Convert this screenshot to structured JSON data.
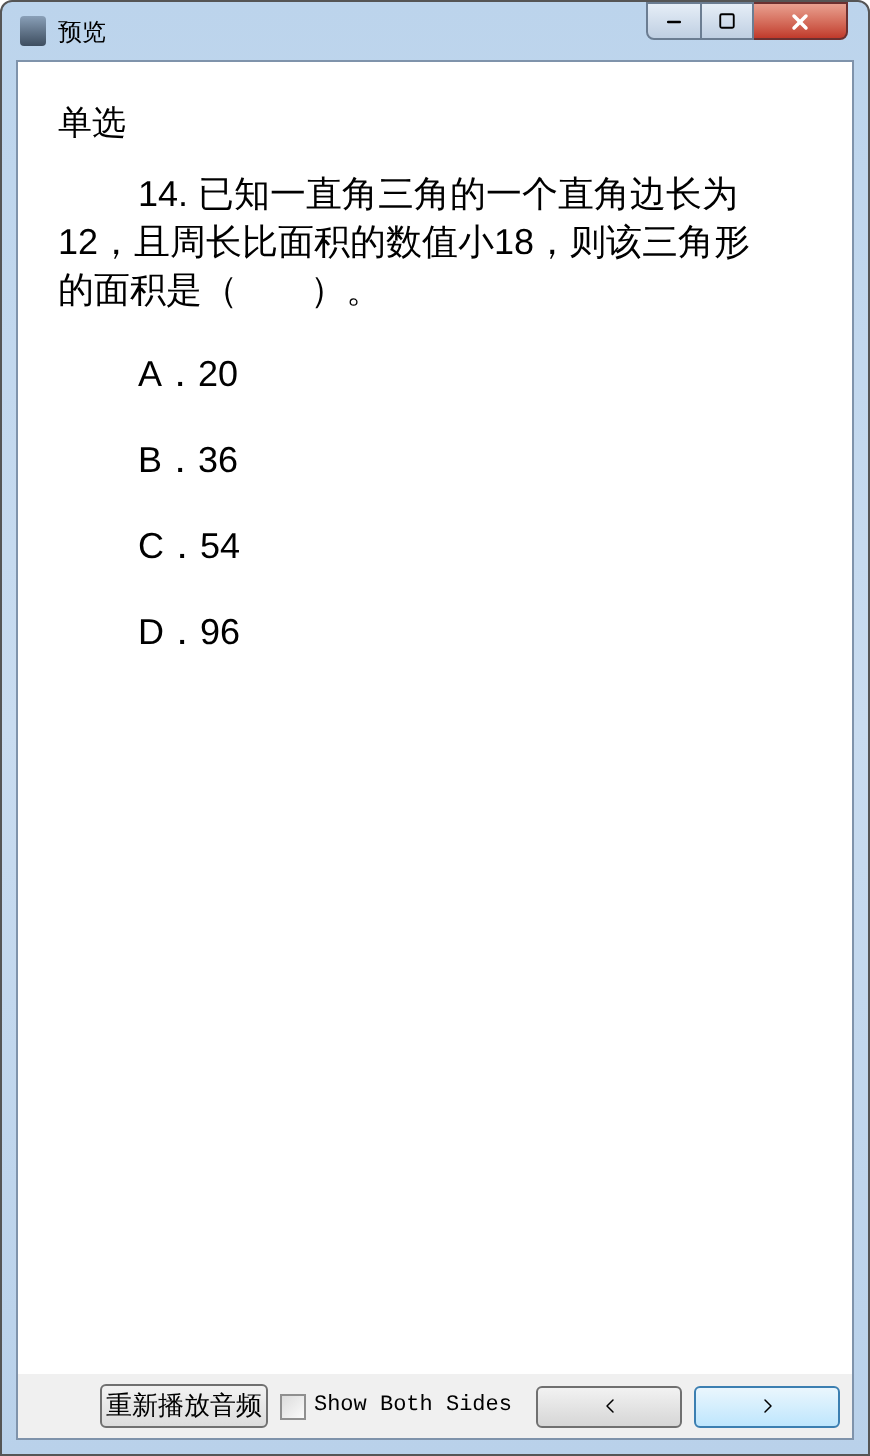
{
  "window": {
    "title": "预览"
  },
  "question": {
    "type": "单选",
    "text": "14. 已知一直角三角的一个直角边长为12，且周长比面积的数值小18，则该三角形的面积是（　　）。"
  },
  "options": [
    {
      "label": "A．20"
    },
    {
      "label": "B．36"
    },
    {
      "label": "C．54"
    },
    {
      "label": "D．96"
    }
  ],
  "footer": {
    "replay_button": "重新播放音频",
    "show_both_sides": {
      "label": "Show Both Sides",
      "checked": false
    }
  }
}
